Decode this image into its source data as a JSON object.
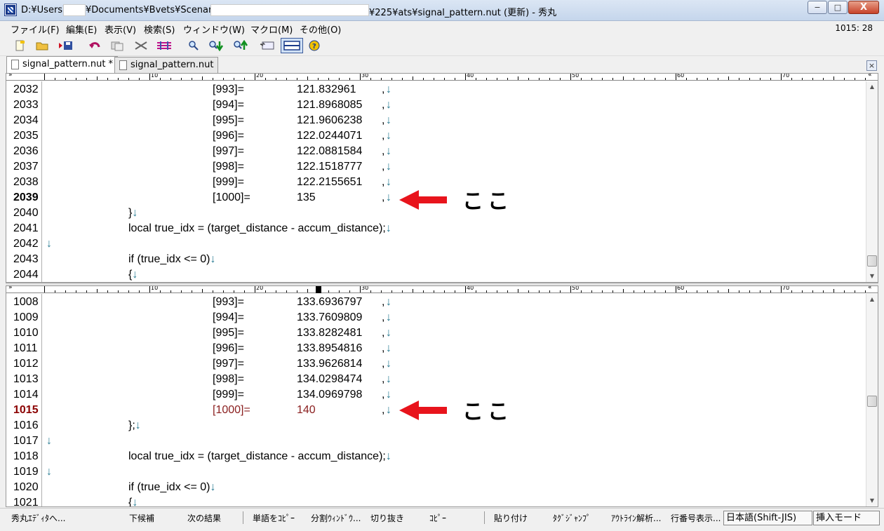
{
  "window": {
    "title_prefix": "D:¥Users¥",
    "title_mid": "¥Documents¥Bvets¥Scenarios¥",
    "title_suffix": "¥225¥ats¥signal_pattern.nut (更新) - 秀丸",
    "btn_minimize": "−",
    "btn_maximize": "□",
    "btn_close": "X"
  },
  "menu": {
    "items": [
      "ファイル(F)",
      "編集(E)",
      "表示(V)",
      "検索(S)",
      "ウィンドウ(W)",
      "マクロ(M)",
      "その他(O)"
    ],
    "cursor_position": "1015: 28"
  },
  "toolbar": {
    "icons": [
      "new-file-icon",
      "open-folder-icon",
      "save-icon",
      "undo-icon",
      "copy-icon",
      "cut-icon",
      "paste-icon",
      "search-icon",
      "search-down-icon",
      "search-up-icon",
      "grep-icon",
      "split-window-icon",
      "help-icon"
    ]
  },
  "tabs": [
    {
      "label": "signal_pattern.nut *",
      "active": true
    },
    {
      "label": "signal_pattern.nut",
      "active": false
    }
  ],
  "tab_close": "×",
  "ruler": {
    "labels": [
      "10",
      "20",
      "30",
      "40",
      "50",
      "60",
      "70"
    ],
    "start_mark": "»",
    "end_mark": "«"
  },
  "newline_glyph": "↓",
  "top_pane": {
    "lines": [
      {
        "num": "2032",
        "index": "[993]=",
        "value": "121.832961",
        "tail": ",",
        "style": "normal"
      },
      {
        "num": "2033",
        "index": "[994]=",
        "value": "121.8968085",
        "tail": ",",
        "style": "normal"
      },
      {
        "num": "2034",
        "index": "[995]=",
        "value": "121.9606238",
        "tail": ",",
        "style": "normal"
      },
      {
        "num": "2035",
        "index": "[996]=",
        "value": "122.0244071",
        "tail": ",",
        "style": "normal"
      },
      {
        "num": "2036",
        "index": "[997]=",
        "value": "122.0881584",
        "tail": ",",
        "style": "normal"
      },
      {
        "num": "2037",
        "index": "[998]=",
        "value": "122.1518777",
        "tail": ",",
        "style": "normal"
      },
      {
        "num": "2038",
        "index": "[999]=",
        "value": "122.2155651",
        "tail": ",",
        "style": "normal"
      },
      {
        "num": "2039",
        "index": "[1000]=",
        "value": "135",
        "tail": ",",
        "style": "bold"
      },
      {
        "num": "2040",
        "code": "}",
        "style": "indent1"
      },
      {
        "num": "2041",
        "code": "local true_idx = (target_distance - accum_distance);",
        "style": "indent1"
      },
      {
        "num": "2042",
        "code": "",
        "style": "indent0"
      },
      {
        "num": "2043",
        "code": "if (true_idx <= 0)",
        "style": "indent1"
      },
      {
        "num": "2044",
        "code": "{",
        "style": "indent1"
      }
    ],
    "annotation": "ここ"
  },
  "bottom_pane": {
    "lines": [
      {
        "num": "1008",
        "index": "[993]=",
        "value": "133.6936797",
        "tail": ",",
        "style": "normal"
      },
      {
        "num": "1009",
        "index": "[994]=",
        "value": "133.7609809",
        "tail": ",",
        "style": "normal"
      },
      {
        "num": "1010",
        "index": "[995]=",
        "value": "133.8282481",
        "tail": ",",
        "style": "normal"
      },
      {
        "num": "1011",
        "index": "[996]=",
        "value": "133.8954816",
        "tail": ",",
        "style": "normal"
      },
      {
        "num": "1012",
        "index": "[997]=",
        "value": "133.9626814",
        "tail": ",",
        "style": "normal"
      },
      {
        "num": "1013",
        "index": "[998]=",
        "value": "134.0298474",
        "tail": ",",
        "style": "normal"
      },
      {
        "num": "1014",
        "index": "[999]=",
        "value": "134.0969798",
        "tail": ",",
        "style": "normal"
      },
      {
        "num": "1015",
        "index": "[1000]=",
        "value": "140",
        "tail": ",",
        "style": "red"
      },
      {
        "num": "1016",
        "code": "};",
        "style": "indent1"
      },
      {
        "num": "1017",
        "code": "",
        "style": "indent0"
      },
      {
        "num": "1018",
        "code": "local true_idx = (target_distance - accum_distance);",
        "style": "indent1"
      },
      {
        "num": "1019",
        "code": "",
        "style": "indent0"
      },
      {
        "num": "1020",
        "code": "if (true_idx <= 0)",
        "style": "indent1"
      },
      {
        "num": "1021",
        "code": "{",
        "style": "indent1"
      }
    ],
    "annotation": "ここ"
  },
  "annotation_color": "#e8141c",
  "status": {
    "fkeys": [
      "秀丸ｴﾃﾞｨﾀへ...",
      "下候補",
      "次の結果",
      "単語をｺﾋﾟｰ",
      "分割ｳｨﾝﾄﾞｳ...",
      "切り抜き",
      "ｺﾋﾟｰ",
      "貼り付け",
      "ﾀｸﾞｼﾞｬﾝﾌﾟ",
      "ｱｳﾄﾗｲﾝ解析...",
      "行番号表示..."
    ],
    "encoding": "日本語(Shift-JIS)",
    "mode": "挿入モード"
  }
}
